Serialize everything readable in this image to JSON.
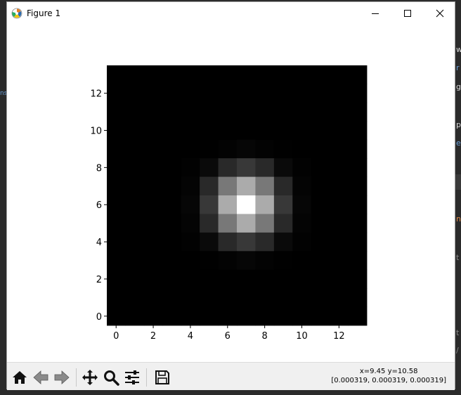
{
  "window": {
    "title": "Figure 1",
    "controls": [
      "minimize",
      "maximize",
      "close"
    ]
  },
  "icons": {
    "app": "matplotlib-logo-icon",
    "minimize": "minimize-icon",
    "maximize": "maximize-icon",
    "close": "close-icon"
  },
  "toolbar": {
    "buttons": [
      {
        "name": "home",
        "icon": "home-icon"
      },
      {
        "name": "back",
        "icon": "back-arrow-icon"
      },
      {
        "name": "forward",
        "icon": "forward-arrow-icon"
      },
      {
        "name": "pan",
        "icon": "pan-arrows-icon"
      },
      {
        "name": "zoom",
        "icon": "zoom-magnifier-icon"
      },
      {
        "name": "configure-subplots",
        "icon": "sliders-icon"
      },
      {
        "name": "save",
        "icon": "save-disk-icon"
      }
    ]
  },
  "status": {
    "coords": "x=9.45 y=10.58",
    "pixel_value": "[0.000319, 0.000319, 0.000319]"
  },
  "chart_data": {
    "type": "heatmap",
    "colormap": "gray",
    "title": "",
    "xlabel": "",
    "ylabel": "",
    "shape": [
      14,
      14
    ],
    "xlim": [
      -0.5,
      13.5
    ],
    "ylim": [
      13.5,
      -0.5
    ],
    "xticks": [
      0,
      2,
      4,
      6,
      8,
      10,
      12
    ],
    "yticks": [
      0,
      2,
      4,
      6,
      8,
      10,
      12
    ],
    "center": [
      7,
      7
    ],
    "sigma": 1.15,
    "values": [
      [
        0,
        0,
        0,
        0,
        0,
        0,
        0,
        0,
        0,
        0,
        0,
        0,
        0,
        0
      ],
      [
        0,
        0,
        0,
        0,
        0,
        0,
        0,
        0,
        0,
        0,
        0,
        0,
        0,
        0
      ],
      [
        0,
        0,
        0,
        0,
        0,
        0,
        0,
        0,
        0,
        0,
        0,
        0,
        0,
        0
      ],
      [
        0,
        0,
        0,
        0,
        0,
        0,
        0,
        0,
        0,
        0,
        0,
        0,
        0,
        0
      ],
      [
        0,
        0,
        0,
        0,
        0,
        0.003,
        0.011,
        0.023,
        0.011,
        0.003,
        0,
        0,
        0,
        0
      ],
      [
        0,
        0,
        0,
        0,
        0.006,
        0.04,
        0.16,
        0.22,
        0.16,
        0.04,
        0.006,
        0,
        0,
        0
      ],
      [
        0,
        0,
        0,
        0,
        0.015,
        0.16,
        0.47,
        0.67,
        0.47,
        0.16,
        0.015,
        0,
        0,
        0
      ],
      [
        0,
        0,
        0,
        0,
        0.023,
        0.22,
        0.67,
        1.0,
        0.67,
        0.22,
        0.023,
        0,
        0,
        0
      ],
      [
        0,
        0,
        0,
        0,
        0.015,
        0.16,
        0.47,
        0.67,
        0.47,
        0.16,
        0.015,
        0,
        0,
        0
      ],
      [
        0,
        0,
        0,
        0,
        0.006,
        0.04,
        0.16,
        0.22,
        0.16,
        0.04,
        0.006,
        0,
        0,
        0
      ],
      [
        0,
        0,
        0,
        0,
        0,
        0.003,
        0.011,
        0.023,
        0.011,
        0.003,
        0,
        0,
        0,
        0
      ],
      [
        0,
        0,
        0,
        0,
        0,
        0,
        0,
        0,
        0,
        0,
        0,
        0,
        0,
        0
      ],
      [
        0,
        0,
        0,
        0,
        0,
        0,
        0,
        0,
        0,
        0,
        0,
        0,
        0,
        0
      ],
      [
        0,
        0,
        0,
        0,
        0,
        0,
        0,
        0,
        0,
        0,
        0,
        0,
        0,
        0
      ]
    ]
  }
}
